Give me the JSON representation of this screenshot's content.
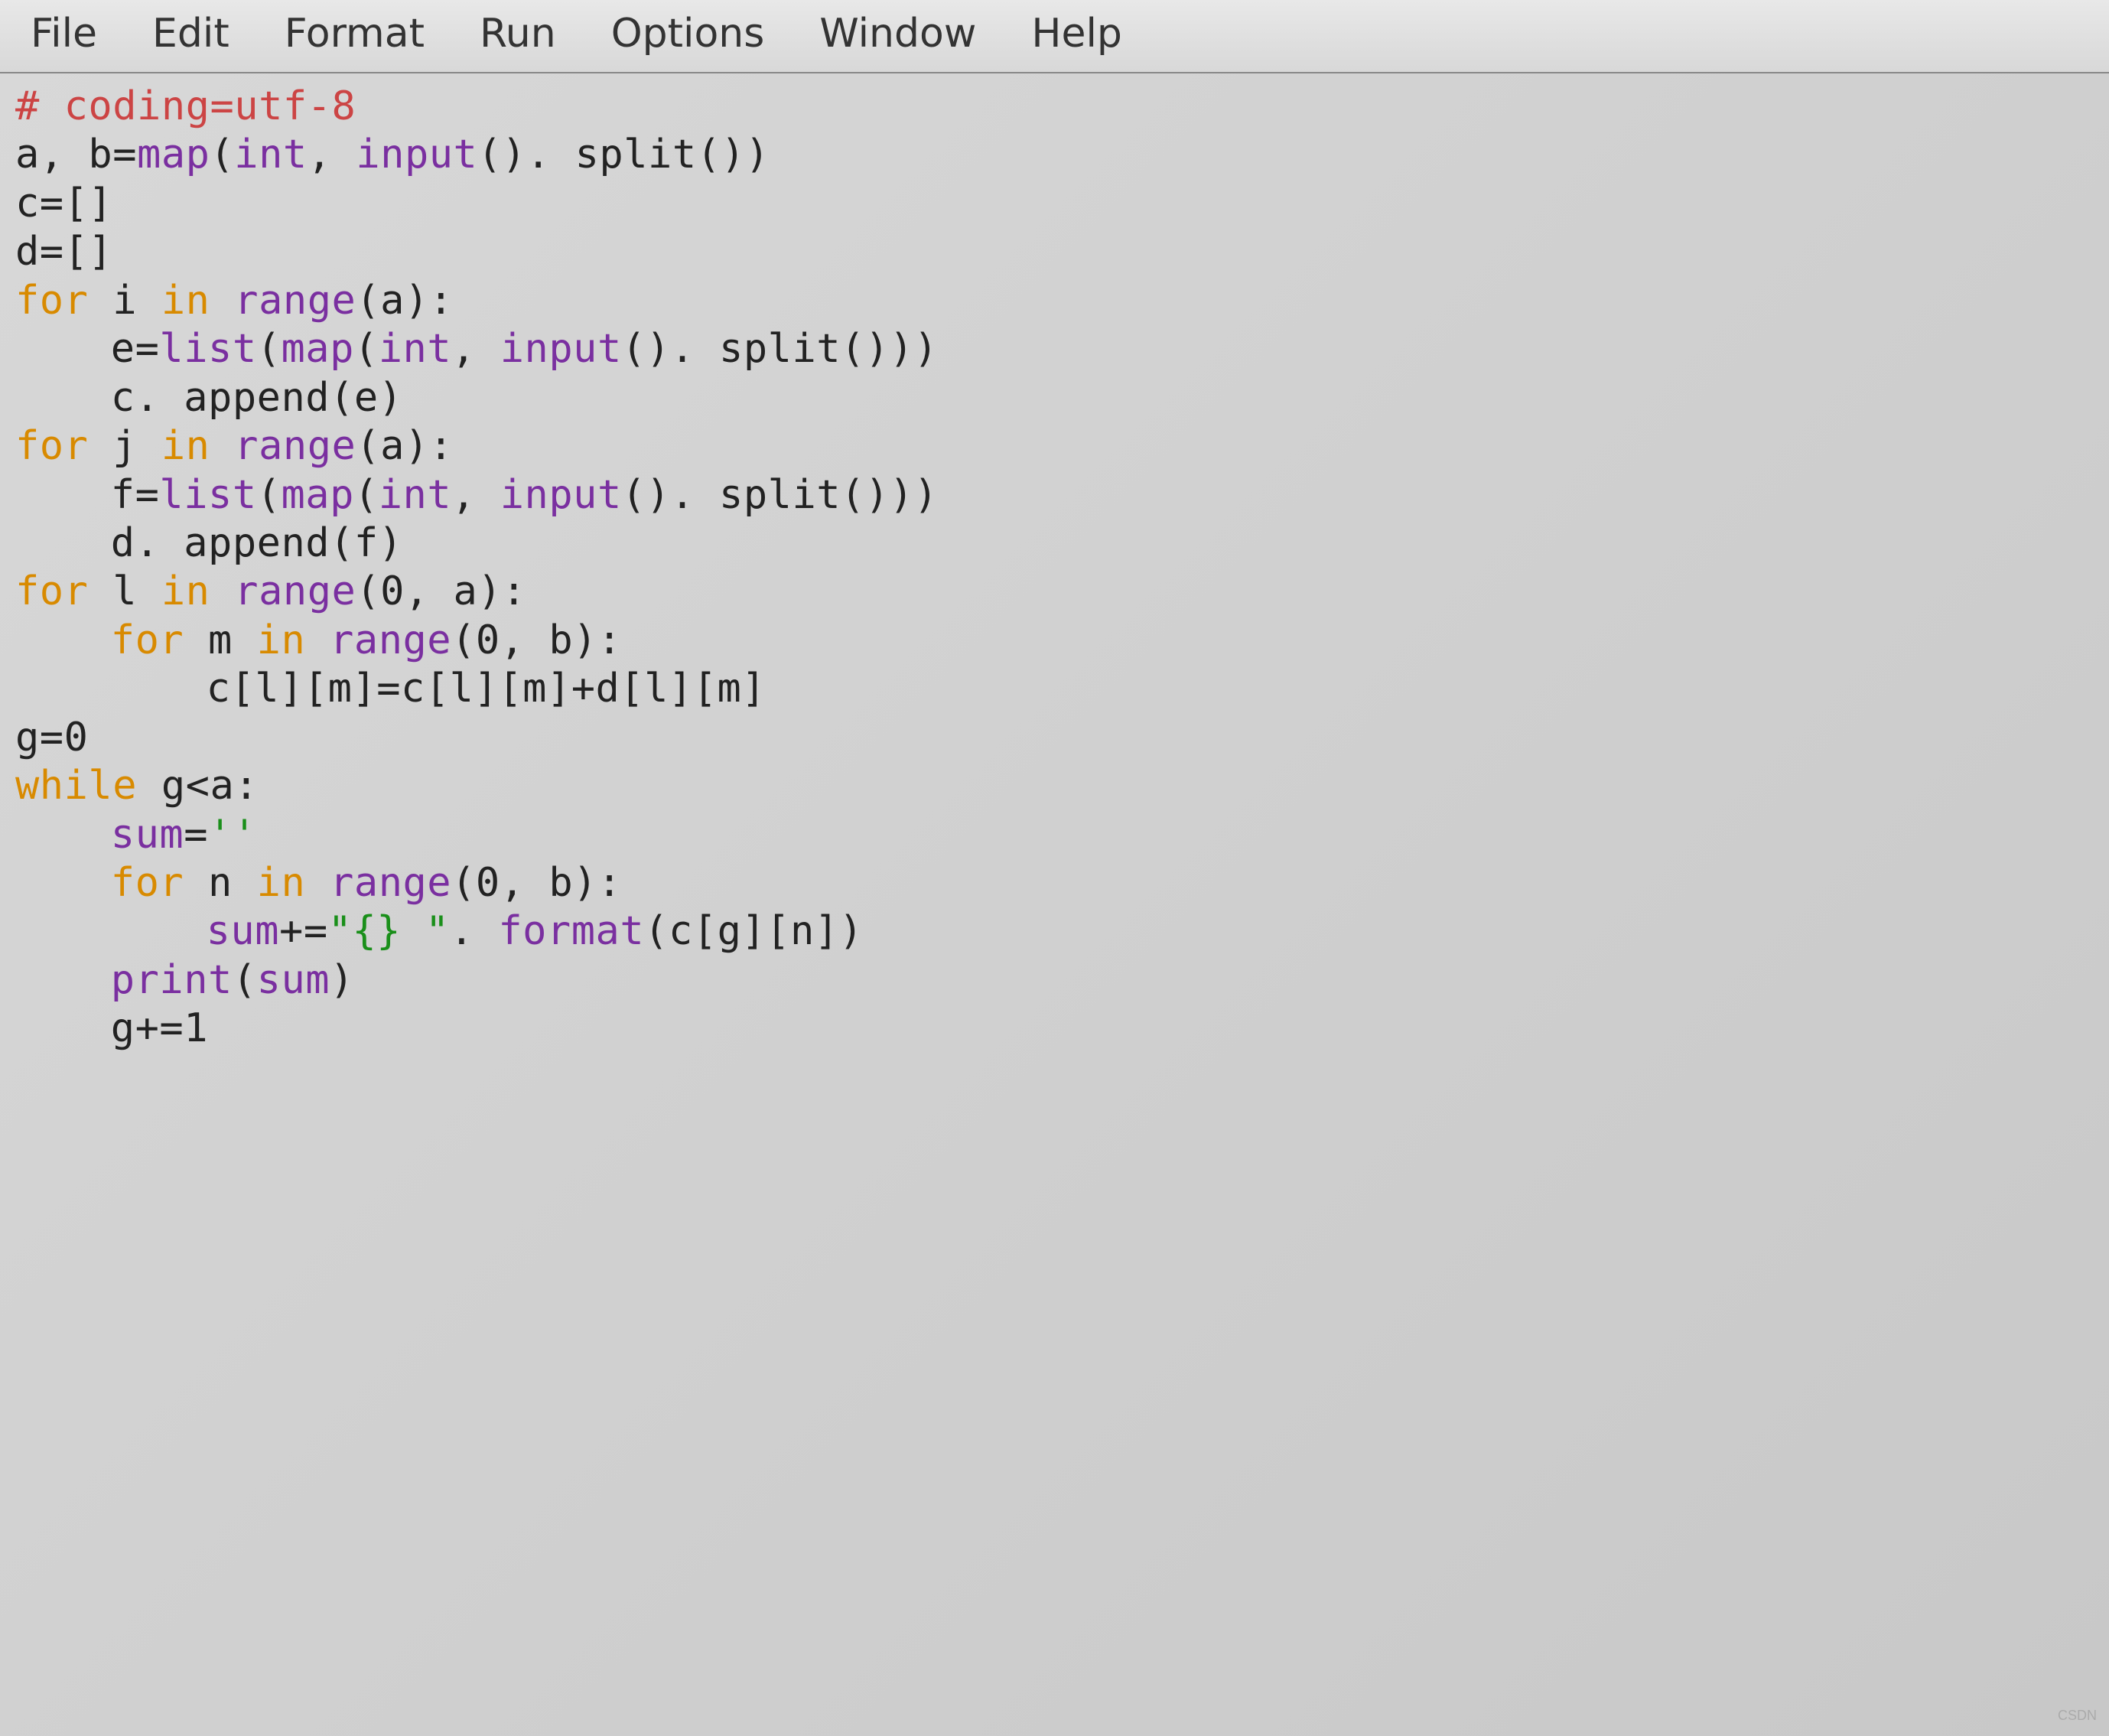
{
  "menubar": {
    "items": [
      "File",
      "Edit",
      "Format",
      "Run",
      "Options",
      "Window",
      "Help"
    ]
  },
  "code": {
    "lines": [
      {
        "indent": 0,
        "tokens": [
          {
            "t": "# coding=utf-8",
            "c": "comment"
          }
        ]
      },
      {
        "indent": 0,
        "tokens": [
          {
            "t": "a, b=",
            "c": "plain"
          },
          {
            "t": "map",
            "c": "builtin"
          },
          {
            "t": "(",
            "c": "plain"
          },
          {
            "t": "int",
            "c": "builtin"
          },
          {
            "t": ", ",
            "c": "plain"
          },
          {
            "t": "input",
            "c": "builtin"
          },
          {
            "t": "(). split())",
            "c": "plain"
          }
        ]
      },
      {
        "indent": 0,
        "tokens": [
          {
            "t": "c=[]",
            "c": "plain"
          }
        ]
      },
      {
        "indent": 0,
        "tokens": [
          {
            "t": "d=[]",
            "c": "plain"
          }
        ]
      },
      {
        "indent": 0,
        "tokens": [
          {
            "t": "for",
            "c": "keyword"
          },
          {
            "t": " i ",
            "c": "plain"
          },
          {
            "t": "in",
            "c": "keyword"
          },
          {
            "t": " ",
            "c": "plain"
          },
          {
            "t": "range",
            "c": "builtin"
          },
          {
            "t": "(a):",
            "c": "plain"
          }
        ]
      },
      {
        "indent": 1,
        "tokens": [
          {
            "t": "e=",
            "c": "plain"
          },
          {
            "t": "list",
            "c": "builtin"
          },
          {
            "t": "(",
            "c": "plain"
          },
          {
            "t": "map",
            "c": "builtin"
          },
          {
            "t": "(",
            "c": "plain"
          },
          {
            "t": "int",
            "c": "builtin"
          },
          {
            "t": ", ",
            "c": "plain"
          },
          {
            "t": "input",
            "c": "builtin"
          },
          {
            "t": "(). split()))",
            "c": "plain"
          }
        ]
      },
      {
        "indent": 1,
        "tokens": [
          {
            "t": "c. append(e)",
            "c": "plain"
          }
        ]
      },
      {
        "indent": 0,
        "tokens": [
          {
            "t": "for",
            "c": "keyword"
          },
          {
            "t": " j ",
            "c": "plain"
          },
          {
            "t": "in",
            "c": "keyword"
          },
          {
            "t": " ",
            "c": "plain"
          },
          {
            "t": "range",
            "c": "builtin"
          },
          {
            "t": "(a):",
            "c": "plain"
          }
        ]
      },
      {
        "indent": 1,
        "tokens": [
          {
            "t": "f=",
            "c": "plain"
          },
          {
            "t": "list",
            "c": "builtin"
          },
          {
            "t": "(",
            "c": "plain"
          },
          {
            "t": "map",
            "c": "builtin"
          },
          {
            "t": "(",
            "c": "plain"
          },
          {
            "t": "int",
            "c": "builtin"
          },
          {
            "t": ", ",
            "c": "plain"
          },
          {
            "t": "input",
            "c": "builtin"
          },
          {
            "t": "(). split()))",
            "c": "plain"
          }
        ]
      },
      {
        "indent": 1,
        "tokens": [
          {
            "t": "d. append(f)",
            "c": "plain"
          }
        ]
      },
      {
        "indent": 0,
        "tokens": [
          {
            "t": "for",
            "c": "keyword"
          },
          {
            "t": " l ",
            "c": "plain"
          },
          {
            "t": "in",
            "c": "keyword"
          },
          {
            "t": " ",
            "c": "plain"
          },
          {
            "t": "range",
            "c": "builtin"
          },
          {
            "t": "(0, a):",
            "c": "plain"
          }
        ]
      },
      {
        "indent": 1,
        "tokens": [
          {
            "t": "for",
            "c": "keyword"
          },
          {
            "t": " m ",
            "c": "plain"
          },
          {
            "t": "in",
            "c": "keyword"
          },
          {
            "t": " ",
            "c": "plain"
          },
          {
            "t": "range",
            "c": "builtin"
          },
          {
            "t": "(0, b):",
            "c": "plain"
          }
        ]
      },
      {
        "indent": 2,
        "tokens": [
          {
            "t": "c[l][m]=c[l][m]+d[l][m]",
            "c": "plain"
          }
        ]
      },
      {
        "indent": 0,
        "tokens": [
          {
            "t": "g=0",
            "c": "plain"
          }
        ]
      },
      {
        "indent": 0,
        "tokens": [
          {
            "t": "while",
            "c": "keyword"
          },
          {
            "t": " g<a:",
            "c": "plain"
          }
        ]
      },
      {
        "indent": 1,
        "tokens": [
          {
            "t": "sum",
            "c": "builtin"
          },
          {
            "t": "=",
            "c": "plain"
          },
          {
            "t": "''",
            "c": "string"
          }
        ]
      },
      {
        "indent": 1,
        "tokens": [
          {
            "t": "for",
            "c": "keyword"
          },
          {
            "t": " n ",
            "c": "plain"
          },
          {
            "t": "in",
            "c": "keyword"
          },
          {
            "t": " ",
            "c": "plain"
          },
          {
            "t": "range",
            "c": "builtin"
          },
          {
            "t": "(0, b):",
            "c": "plain"
          }
        ]
      },
      {
        "indent": 2,
        "tokens": [
          {
            "t": "sum",
            "c": "builtin"
          },
          {
            "t": "+=",
            "c": "plain"
          },
          {
            "t": "\"{} \"",
            "c": "string"
          },
          {
            "t": ". ",
            "c": "plain"
          },
          {
            "t": "format",
            "c": "builtin"
          },
          {
            "t": "(c[g][n])",
            "c": "plain"
          }
        ]
      },
      {
        "indent": 1,
        "tokens": [
          {
            "t": "print",
            "c": "builtin"
          },
          {
            "t": "(",
            "c": "plain"
          },
          {
            "t": "sum",
            "c": "builtin"
          },
          {
            "t": ")",
            "c": "plain"
          }
        ]
      },
      {
        "indent": 1,
        "tokens": [
          {
            "t": "g+=1",
            "c": "plain"
          }
        ]
      }
    ]
  },
  "watermark": "CSDN"
}
